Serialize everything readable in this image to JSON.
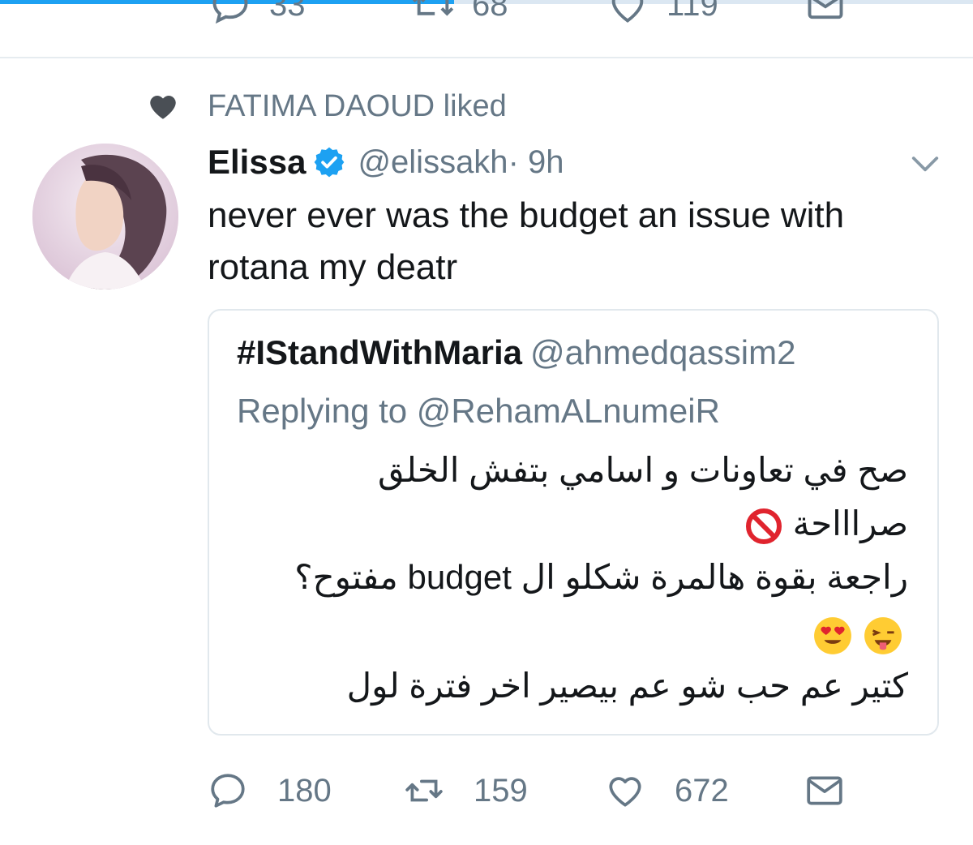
{
  "previous_tweet": {
    "reply_count": "33",
    "retweet_count": "68",
    "like_count": "119"
  },
  "social_context": {
    "icon": "heart-icon",
    "text": "FATIMA DAOUD liked"
  },
  "tweet": {
    "author_name": "Elissa",
    "verified_icon": "verified-badge-icon",
    "handle": "@elissakh",
    "time": " · 9h",
    "text": "never ever was the budget an issue with rotana my deatr",
    "quoted": {
      "author_name": "#IStandWithMaria",
      "handle": "@ahmedqassim2",
      "replying_to": "Replying to @RehamALnumeiR",
      "lines": [
        "صح في تعاونات و اسامي بتفش الخلق",
        "صراااحة",
        "راجعة بقوة هالمرة شكلو ال budget مفتوح؟",
        "كتير عم حب شو عم بيصير اخر فترة لول"
      ]
    },
    "reply_count": "180",
    "retweet_count": "159",
    "like_count": "672"
  },
  "colors": {
    "accent": "#1da1f2",
    "secondary_text": "#657786",
    "border": "#e1e8ed"
  }
}
